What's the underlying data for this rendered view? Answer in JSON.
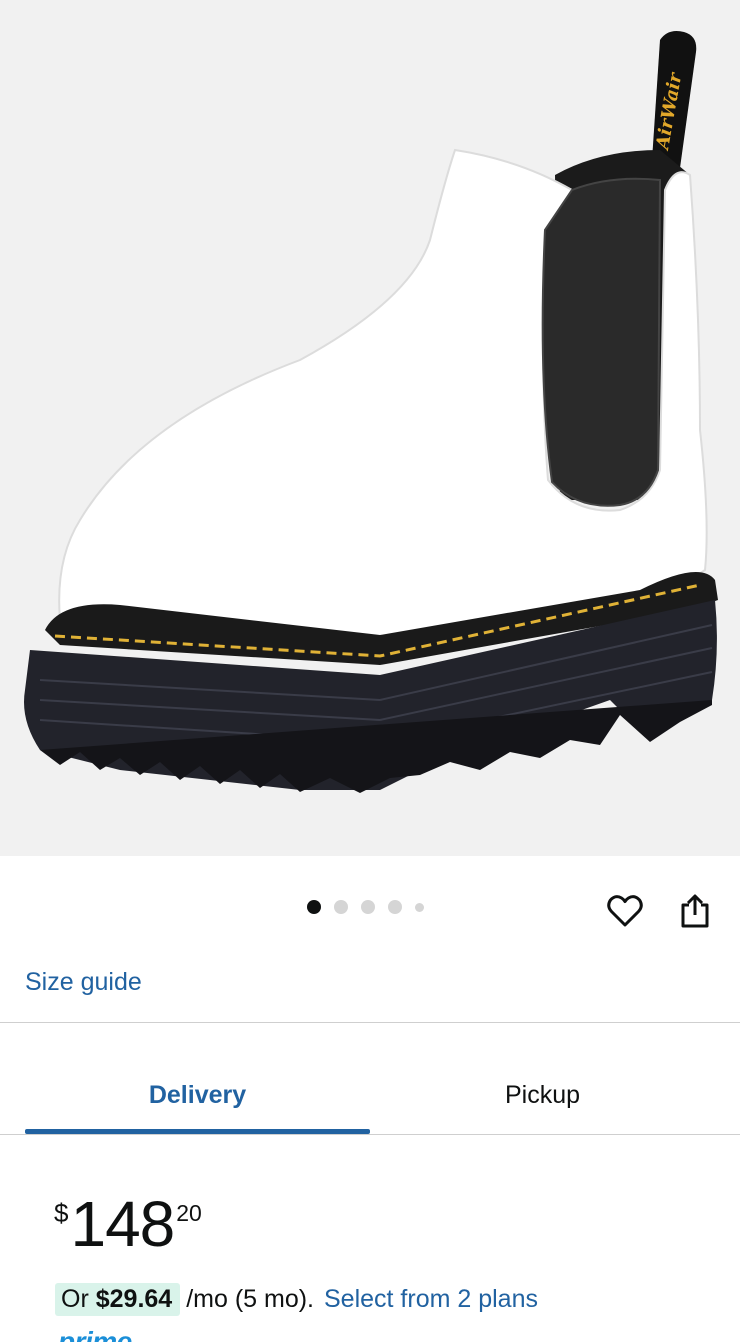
{
  "product": {
    "image_alt": "White Chelsea boot with black elastic side panel and black platform sole",
    "heel_tab_text": "AirWair"
  },
  "carousel": {
    "total_images": 5,
    "active_index": 0
  },
  "actions": {
    "favorite_icon": "heart-icon",
    "share_icon": "share-icon"
  },
  "size_guide_label": "Size guide",
  "tabs": [
    {
      "label": "Delivery",
      "active": true
    },
    {
      "label": "Pickup",
      "active": false
    }
  ],
  "price": {
    "currency_symbol": "$",
    "whole": "148",
    "fraction": "20"
  },
  "installments": {
    "prefix": "Or",
    "amount": "$29.64",
    "term": "/mo (5 mo).",
    "link_label": "Select from 2 plans"
  },
  "prime_label": "prime",
  "colors": {
    "link_blue": "#2162a1",
    "highlight_green": "#d9f3ea",
    "prime_blue": "#1b8fd8"
  }
}
